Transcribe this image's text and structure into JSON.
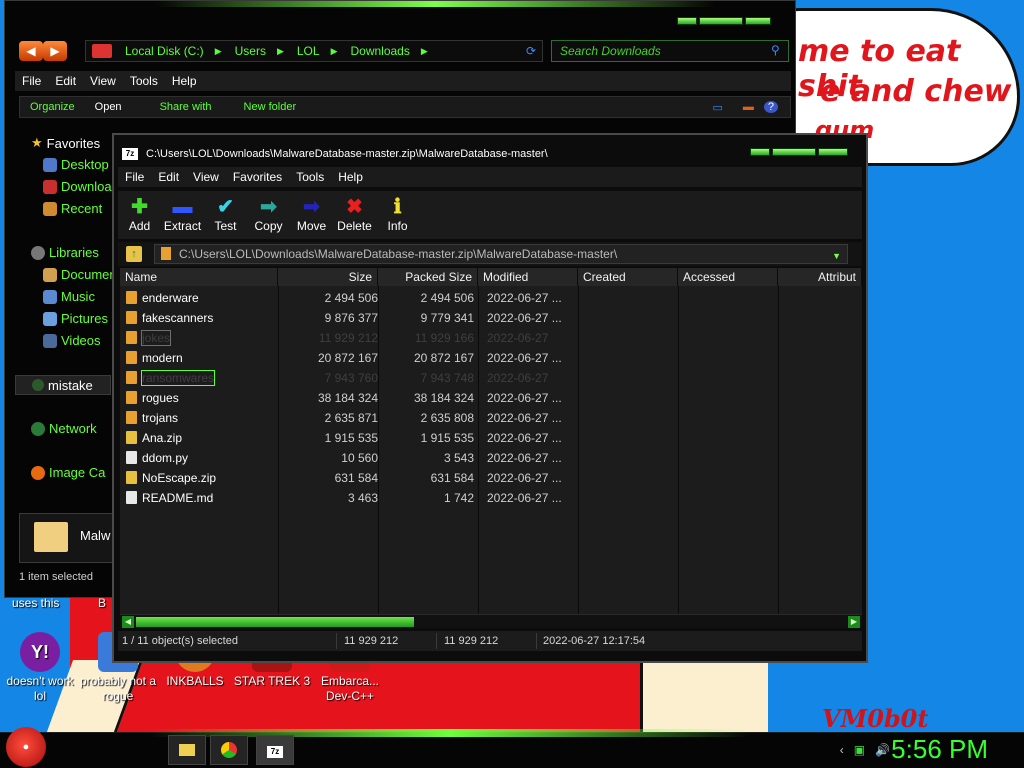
{
  "wallpaper": {
    "bubble_lines": [
      "me to eat shit",
      "e and chew",
      "gum"
    ],
    "signature": "VM0b0t"
  },
  "desktop_icons": [
    {
      "label": "doesn't work lol",
      "icon": "yahoo-messenger-icon"
    },
    {
      "label": "probably not a rogue",
      "icon": "installer-icon"
    },
    {
      "label": "INKBALLS",
      "icon": "inkballs-icon"
    },
    {
      "label": "STAR TREK 3",
      "icon": "star-trek-icon"
    },
    {
      "label": "Embarca... Dev-C++",
      "icon": "devcpp-icon"
    }
  ],
  "desktop_partial_labels": {
    "left": "uses this",
    "right": "B"
  },
  "explorer": {
    "breadcrumb": [
      "Local Disk (C:)",
      "Users",
      "LOL",
      "Downloads"
    ],
    "search_placeholder": "Search Downloads",
    "menu": [
      "File",
      "Edit",
      "View",
      "Tools",
      "Help"
    ],
    "commands": [
      "Organize",
      "Open",
      "Share with",
      "New folder"
    ],
    "nav": {
      "favorites": "Favorites",
      "desktop": "Desktop",
      "downloads": "Downloads",
      "recent": "Recent",
      "libraries": "Libraries",
      "documents": "Documents",
      "music": "Music",
      "pictures": "Pictures",
      "videos": "Videos",
      "mistake": "mistake",
      "network": "Network",
      "image_capture": "Image Ca"
    },
    "preview_name": "Malw",
    "status": "1 item selected"
  },
  "zip": {
    "title": "C:\\Users\\LOL\\Downloads\\MalwareDatabase-master.zip\\MalwareDatabase-master\\",
    "menu": [
      "File",
      "Edit",
      "View",
      "Favorites",
      "Tools",
      "Help"
    ],
    "toolbar": [
      {
        "label": "Add",
        "icon": "add-icon",
        "glyph": "✚",
        "color": "#3fdc2a"
      },
      {
        "label": "Extract",
        "icon": "extract-icon",
        "glyph": "▬",
        "color": "#2f56ff"
      },
      {
        "label": "Test",
        "icon": "test-icon",
        "glyph": "✔",
        "color": "#39d4e8"
      },
      {
        "label": "Copy",
        "icon": "copy-icon",
        "glyph": "➡",
        "color": "#2aa89a"
      },
      {
        "label": "Move",
        "icon": "move-icon",
        "glyph": "➡",
        "color": "#2424b8"
      },
      {
        "label": "Delete",
        "icon": "delete-icon",
        "glyph": "✖",
        "color": "#e82020"
      },
      {
        "label": "Info",
        "icon": "info-icon",
        "glyph": "ℹ",
        "color": "#f0e030"
      }
    ],
    "path": "C:\\Users\\LOL\\Downloads\\MalwareDatabase-master.zip\\MalwareDatabase-master\\",
    "columns": [
      "Name",
      "Size",
      "Packed Size",
      "Modified",
      "Created",
      "Accessed",
      "Attribut"
    ],
    "files": [
      {
        "name": "enderware",
        "size": "2 494 506",
        "packed": "2 494 506",
        "modified": "2022-06-27 ...",
        "type": "folder",
        "state": ""
      },
      {
        "name": "fakescanners",
        "size": "9 876 377",
        "packed": "9 779 341",
        "modified": "2022-06-27 ...",
        "type": "folder",
        "state": ""
      },
      {
        "name": "jokes",
        "size": "11 929 212",
        "packed": "11 929 166",
        "modified": "2022-06-27",
        "type": "folder",
        "state": "dim sel-box"
      },
      {
        "name": "modern",
        "size": "20 872 167",
        "packed": "20 872 167",
        "modified": "2022-06-27 ...",
        "type": "folder",
        "state": ""
      },
      {
        "name": "ransomwares",
        "size": "7 943 760",
        "packed": "7 943 748",
        "modified": "2022-06-27",
        "type": "folder",
        "state": "dim focus"
      },
      {
        "name": "rogues",
        "size": "38 184 324",
        "packed": "38 184 324",
        "modified": "2022-06-27 ...",
        "type": "folder",
        "state": ""
      },
      {
        "name": "trojans",
        "size": "2 635 871",
        "packed": "2 635 808",
        "modified": "2022-06-27 ...",
        "type": "folder",
        "state": ""
      },
      {
        "name": "Ana.zip",
        "size": "1 915 535",
        "packed": "1 915 535",
        "modified": "2022-06-27 ...",
        "type": "zip",
        "state": ""
      },
      {
        "name": "ddom.py",
        "size": "10 560",
        "packed": "3 543",
        "modified": "2022-06-27 ...",
        "type": "file",
        "state": ""
      },
      {
        "name": "NoEscape.zip",
        "size": "631 584",
        "packed": "631 584",
        "modified": "2022-06-27 ...",
        "type": "zip",
        "state": ""
      },
      {
        "name": "README.md",
        "size": "3 463",
        "packed": "1 742",
        "modified": "2022-06-27 ...",
        "type": "file",
        "state": ""
      }
    ],
    "status": {
      "selection": "1 / 11 object(s) selected",
      "size": "11 929 212",
      "packed": "11 929 212",
      "modified": "2022-06-27 12:17:54"
    }
  },
  "taskbar": {
    "clock": "5:56 PM",
    "start_icon": "angry-bird-start-icon"
  },
  "colors": {
    "accent": "#5cff3a",
    "folder": "#e8a030"
  }
}
